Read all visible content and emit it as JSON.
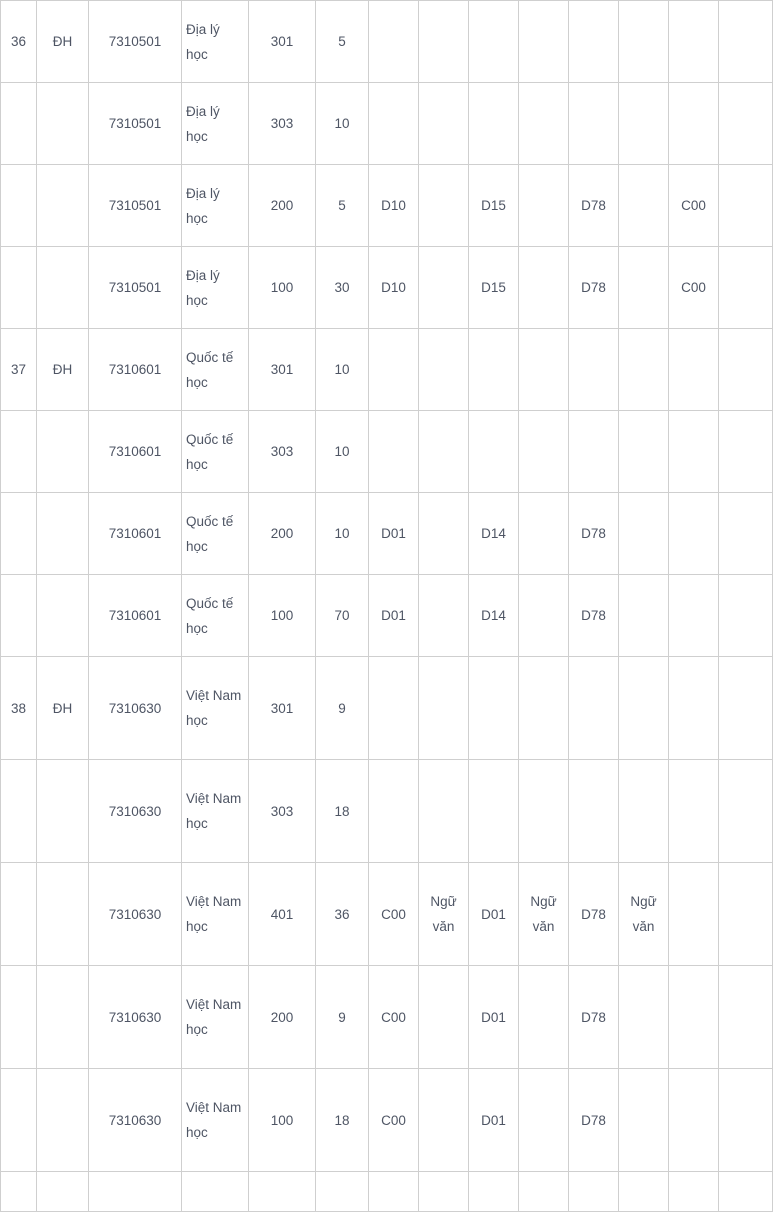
{
  "table": {
    "columns": [
      {
        "key": "stt",
        "name": "stt"
      },
      {
        "key": "level",
        "name": "education-level"
      },
      {
        "key": "code",
        "name": "major-code"
      },
      {
        "key": "major",
        "name": "major-name"
      },
      {
        "key": "method",
        "name": "admission-method-code"
      },
      {
        "key": "quota",
        "name": "quota"
      },
      {
        "key": "b1",
        "name": "subject-block-1"
      },
      {
        "key": "b2",
        "name": "subject-block-2"
      },
      {
        "key": "b3",
        "name": "subject-block-3"
      },
      {
        "key": "b4",
        "name": "subject-block-4"
      },
      {
        "key": "b5",
        "name": "subject-block-5"
      },
      {
        "key": "b6",
        "name": "subject-block-6"
      },
      {
        "key": "b7",
        "name": "subject-block-7"
      },
      {
        "key": "b8",
        "name": "subject-block-8"
      }
    ],
    "rows": [
      {
        "height": "h-2line",
        "stt": "36",
        "level": "ĐH",
        "code": "7310501",
        "major": "Địa lý học",
        "method": "301",
        "quota": "5",
        "b1": "",
        "b2": "",
        "b3": "",
        "b4": "",
        "b5": "",
        "b6": "",
        "b7": "",
        "b8": ""
      },
      {
        "height": "h-2line",
        "stt": "",
        "level": "",
        "code": "7310501",
        "major": "Địa lý học",
        "method": "303",
        "quota": "10",
        "b1": "",
        "b2": "",
        "b3": "",
        "b4": "",
        "b5": "",
        "b6": "",
        "b7": "",
        "b8": ""
      },
      {
        "height": "h-2line",
        "stt": "",
        "level": "",
        "code": "7310501",
        "major": "Địa lý học",
        "method": "200",
        "quota": "5",
        "b1": "D10",
        "b2": "",
        "b3": "D15",
        "b4": "",
        "b5": "D78",
        "b6": "",
        "b7": "C00",
        "b8": ""
      },
      {
        "height": "h-2line",
        "stt": "",
        "level": "",
        "code": "7310501",
        "major": "Địa lý học",
        "method": "100",
        "quota": "30",
        "b1": "D10",
        "b2": "",
        "b3": "D15",
        "b4": "",
        "b5": "D78",
        "b6": "",
        "b7": "C00",
        "b8": ""
      },
      {
        "height": "h-2line",
        "stt": "37",
        "level": "ĐH",
        "code": "7310601",
        "major": "Quốc tế học",
        "method": "301",
        "quota": "10",
        "b1": "",
        "b2": "",
        "b3": "",
        "b4": "",
        "b5": "",
        "b6": "",
        "b7": "",
        "b8": ""
      },
      {
        "height": "h-2line",
        "stt": "",
        "level": "",
        "code": "7310601",
        "major": "Quốc tế học",
        "method": "303",
        "quota": "10",
        "b1": "",
        "b2": "",
        "b3": "",
        "b4": "",
        "b5": "",
        "b6": "",
        "b7": "",
        "b8": ""
      },
      {
        "height": "h-2line",
        "stt": "",
        "level": "",
        "code": "7310601",
        "major": "Quốc tế học",
        "method": "200",
        "quota": "10",
        "b1": "D01",
        "b2": "",
        "b3": "D14",
        "b4": "",
        "b5": "D78",
        "b6": "",
        "b7": "",
        "b8": ""
      },
      {
        "height": "h-2line",
        "stt": "",
        "level": "",
        "code": "7310601",
        "major": "Quốc tế học",
        "method": "100",
        "quota": "70",
        "b1": "D01",
        "b2": "",
        "b3": "D14",
        "b4": "",
        "b5": "D78",
        "b6": "",
        "b7": "",
        "b8": ""
      },
      {
        "height": "h-3line",
        "stt": "38",
        "level": "ĐH",
        "code": "7310630",
        "major": "Việt Nam học",
        "method": "301",
        "quota": "9",
        "b1": "",
        "b2": "",
        "b3": "",
        "b4": "",
        "b5": "",
        "b6": "",
        "b7": "",
        "b8": ""
      },
      {
        "height": "h-3line",
        "stt": "",
        "level": "",
        "code": "7310630",
        "major": "Việt Nam học",
        "method": "303",
        "quota": "18",
        "b1": "",
        "b2": "",
        "b3": "",
        "b4": "",
        "b5": "",
        "b6": "",
        "b7": "",
        "b8": ""
      },
      {
        "height": "h-3line",
        "stt": "",
        "level": "",
        "code": "7310630",
        "major": "Việt Nam học",
        "method": "401",
        "quota": "36",
        "b1": "C00",
        "b2": "Ngữ văn",
        "b3": "D01",
        "b4": "Ngữ văn",
        "b5": "D78",
        "b6": "Ngữ văn",
        "b7": "",
        "b8": ""
      },
      {
        "height": "h-3line",
        "stt": "",
        "level": "",
        "code": "7310630",
        "major": "Việt Nam học",
        "method": "200",
        "quota": "9",
        "b1": "C00",
        "b2": "",
        "b3": "D01",
        "b4": "",
        "b5": "D78",
        "b6": "",
        "b7": "",
        "b8": ""
      },
      {
        "height": "h-3line",
        "stt": "",
        "level": "",
        "code": "7310630",
        "major": "Việt Nam học",
        "method": "100",
        "quota": "18",
        "b1": "C00",
        "b2": "",
        "b3": "D01",
        "b4": "",
        "b5": "D78",
        "b6": "",
        "b7": "",
        "b8": ""
      },
      {
        "height": "h-partial",
        "stt": "",
        "level": "",
        "code": "",
        "major": "",
        "method": "",
        "quota": "",
        "b1": "",
        "b2": "",
        "b3": "",
        "b4": "",
        "b5": "",
        "b6": "",
        "b7": "",
        "b8": ""
      }
    ]
  },
  "style": {
    "border_color": "#cfcfcf",
    "text_color": "#4e5564",
    "background": "#ffffff"
  }
}
